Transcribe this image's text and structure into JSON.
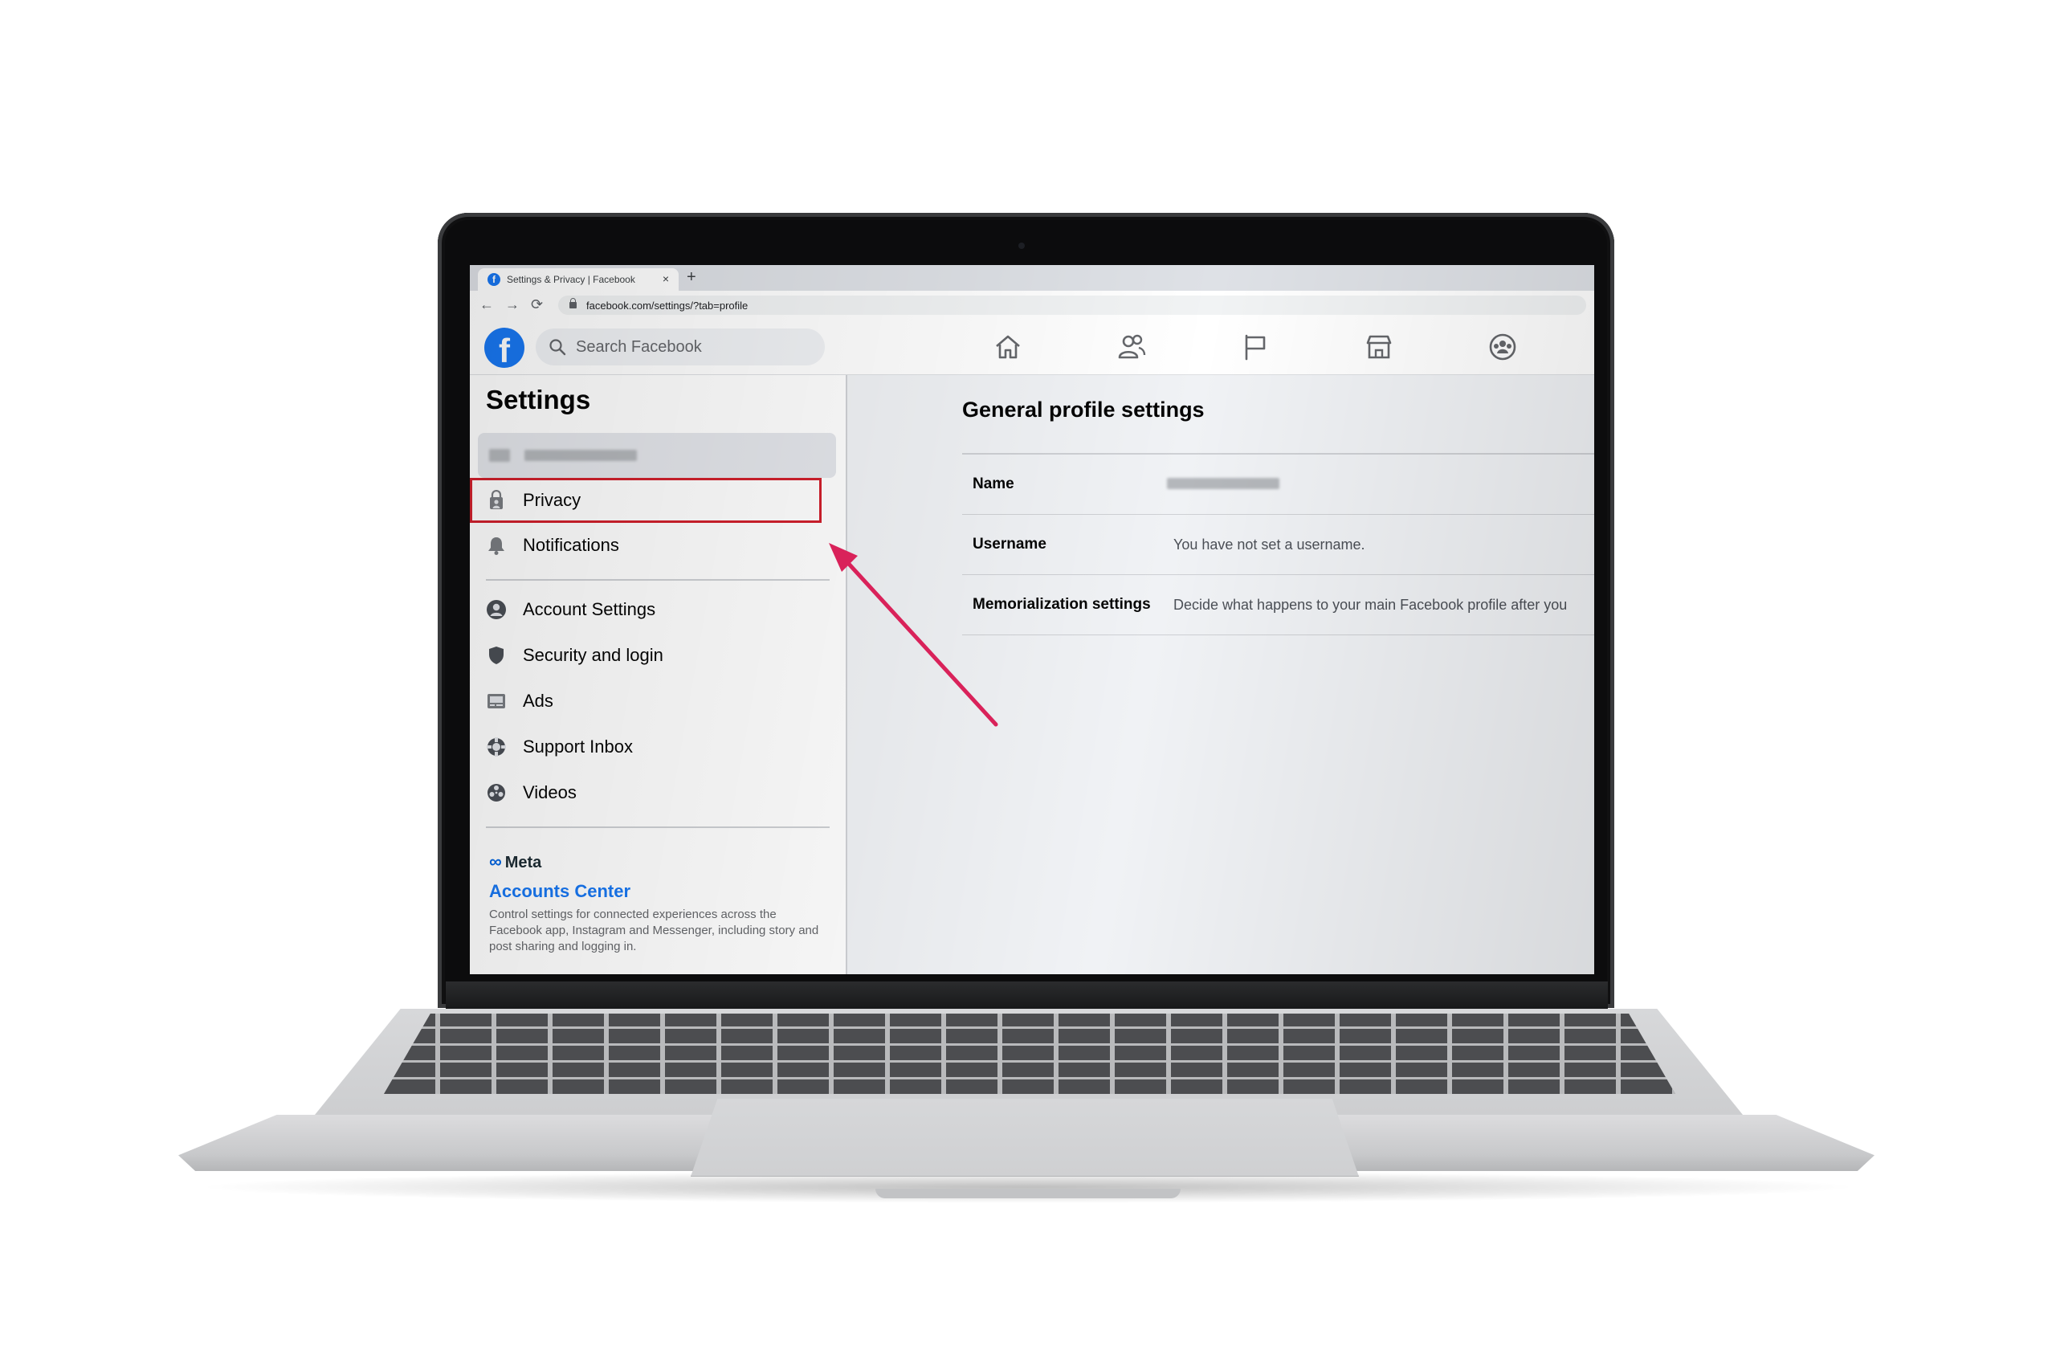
{
  "browser": {
    "tab_title": "Settings & Privacy | Facebook",
    "tab_close": "×",
    "new_tab": "+",
    "url": "facebook.com/settings/?tab=profile",
    "back": "←",
    "forward": "→",
    "reload": "⟳"
  },
  "fb": {
    "logo_letter": "f",
    "search_placeholder": "Search Facebook"
  },
  "sidebar": {
    "title": "Settings",
    "items": [
      {
        "label": "Privacy"
      },
      {
        "label": "Notifications"
      },
      {
        "label": "Account Settings"
      },
      {
        "label": "Security and login"
      },
      {
        "label": "Ads"
      },
      {
        "label": "Support Inbox"
      },
      {
        "label": "Videos"
      }
    ],
    "meta_label": "Meta",
    "meta_symbol": "∞",
    "accounts_center": "Accounts Center",
    "accounts_center_desc": "Control settings for connected experiences across the Facebook app, Instagram and Messenger, including story and post sharing and logging in."
  },
  "main": {
    "title": "General profile settings",
    "rows": [
      {
        "key": "Name",
        "value": ""
      },
      {
        "key": "Username",
        "value": "You have not set a username."
      },
      {
        "key": "Memorialization settings",
        "value": "Decide what happens to your main Facebook profile after you"
      }
    ]
  },
  "annotation": {
    "highlight_color": "#d0202c",
    "arrow_color": "#d9225a"
  },
  "colors": {
    "facebook_blue": "#1877f2",
    "page_bg": "#f0f2f5"
  }
}
